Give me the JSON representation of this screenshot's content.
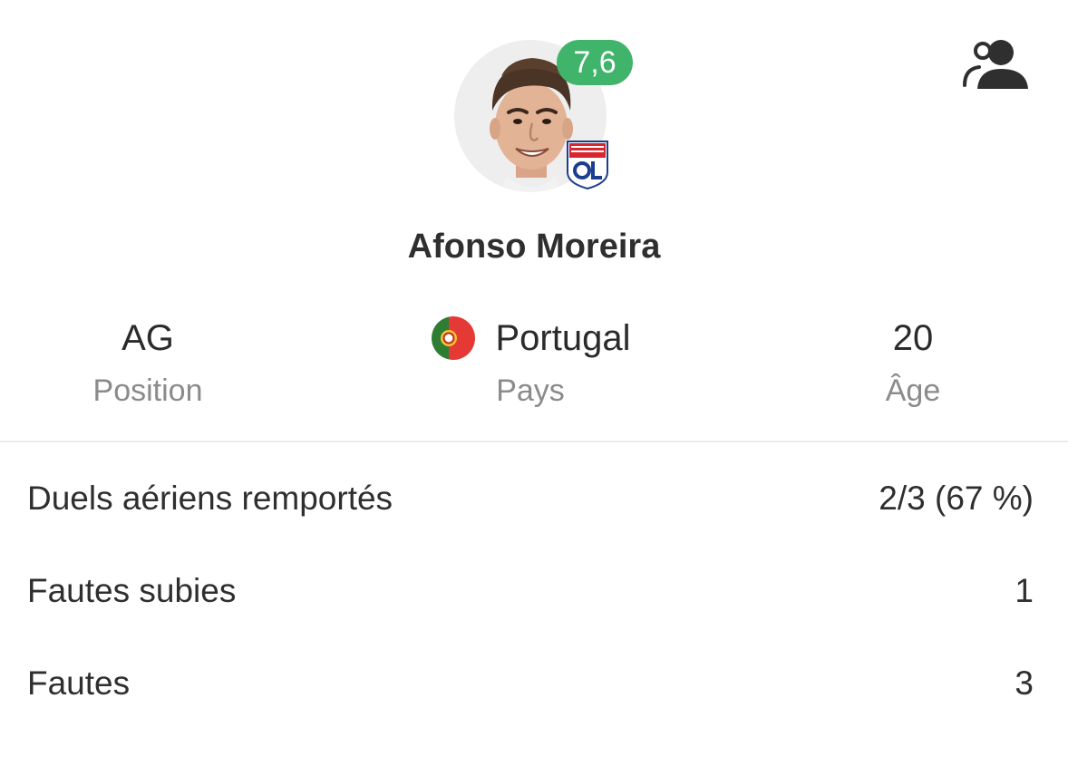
{
  "player": {
    "name": "Afonso Moreira",
    "rating": "7,6",
    "club_badge_text": "OLYMPIQUE LYONNAIS"
  },
  "info": {
    "position": {
      "value": "AG",
      "label": "Position"
    },
    "country": {
      "value": "Portugal",
      "label": "Pays"
    },
    "age": {
      "value": "20",
      "label": "Âge"
    }
  },
  "stats": [
    {
      "label": "Duels aériens remportés",
      "value": "2/3 (67 %)"
    },
    {
      "label": "Fautes subies",
      "value": "1"
    },
    {
      "label": "Fautes",
      "value": "3"
    }
  ],
  "icons": {
    "players_button": "players-icon",
    "flag": "portugal-flag-icon",
    "club": "olympique-lyonnais-crest-icon"
  },
  "colors": {
    "rating_badge": "#3fb46a",
    "label_gray": "#8b8b8b",
    "text_dark": "#2f2f2f",
    "divider": "#ececec"
  }
}
